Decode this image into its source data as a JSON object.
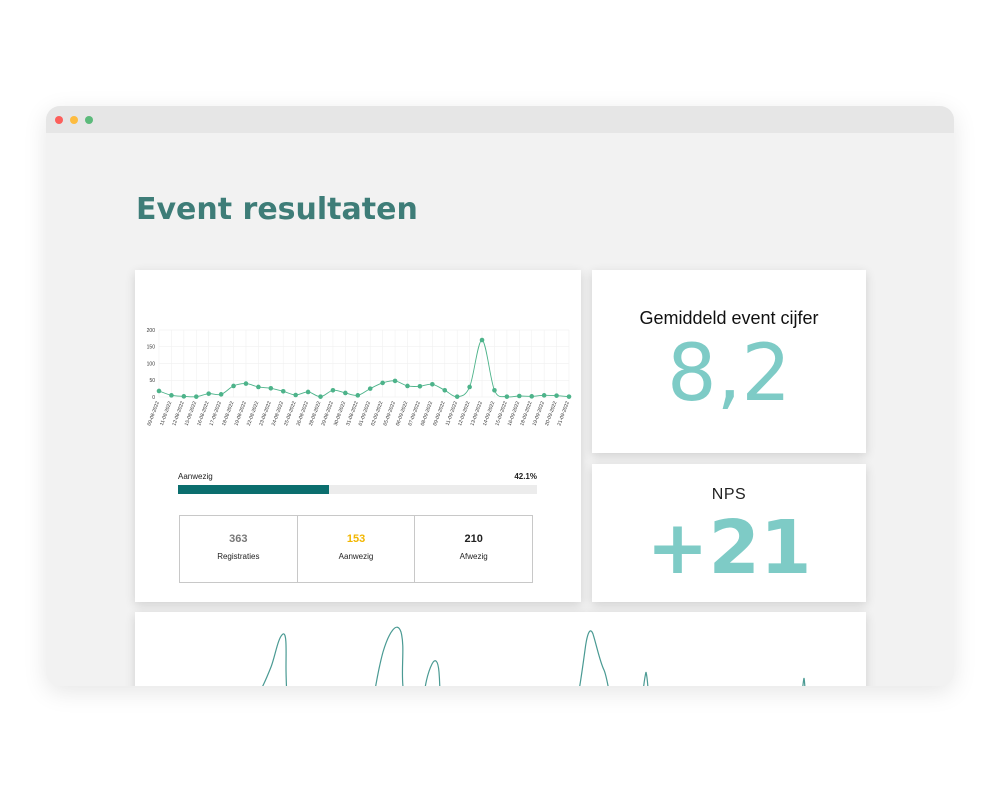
{
  "page": {
    "title": "Event resultaten"
  },
  "window": {
    "controls": [
      "close",
      "minimize",
      "maximize"
    ]
  },
  "chart_data": {
    "type": "line",
    "x": [
      "09-08-2022",
      "11-08-2022",
      "12-08-2022",
      "15-08-2022",
      "16-08-2022",
      "17-08-2022",
      "18-08-2022",
      "19-08-2022",
      "22-08-2022",
      "23-08-2022",
      "24-08-2022",
      "25-08-2022",
      "26-08-2022",
      "28-08-2022",
      "29-08-2022",
      "30-08-2022",
      "31-08-2022",
      "01-09-2022",
      "02-09-2022",
      "05-09-2022",
      "06-09-2022",
      "07-09-2022",
      "08-09-2022",
      "09-09-2022",
      "11-09-2022",
      "12-09-2022",
      "13-09-2022",
      "14-09-2022",
      "15-09-2022",
      "16-09-2022",
      "18-09-2022",
      "19-09-2022",
      "20-09-2022",
      "21-09-2022"
    ],
    "values": [
      18,
      5,
      2,
      1,
      10,
      8,
      33,
      40,
      30,
      26,
      17,
      6,
      15,
      1,
      20,
      12,
      5,
      25,
      42,
      48,
      33,
      32,
      38,
      20,
      1,
      30,
      170,
      20,
      1,
      3,
      2,
      5,
      4,
      1
    ],
    "ylim": [
      0,
      200
    ],
    "yticks": [
      0,
      50,
      100,
      150,
      200
    ],
    "grid": true,
    "color": "#4db38a"
  },
  "attendance": {
    "label": "Aanwezig",
    "percent_text": "42.1%",
    "fraction": 0.421
  },
  "stats": [
    {
      "value": "363",
      "label": "Registraties",
      "color": "#777777"
    },
    {
      "value": "153",
      "label": "Aanwezig",
      "color": "#f2b600"
    },
    {
      "value": "210",
      "label": "Afwezig",
      "color": "#222222"
    }
  ],
  "score": {
    "title": "Gemiddeld event cijfer",
    "value": "8,2"
  },
  "nps": {
    "title": "NPS",
    "value": "+21"
  },
  "colors": {
    "accent": "#3e7d78",
    "metric": "#7ecbc6",
    "bar": "#0b6e6e",
    "line": "#4db38a"
  }
}
